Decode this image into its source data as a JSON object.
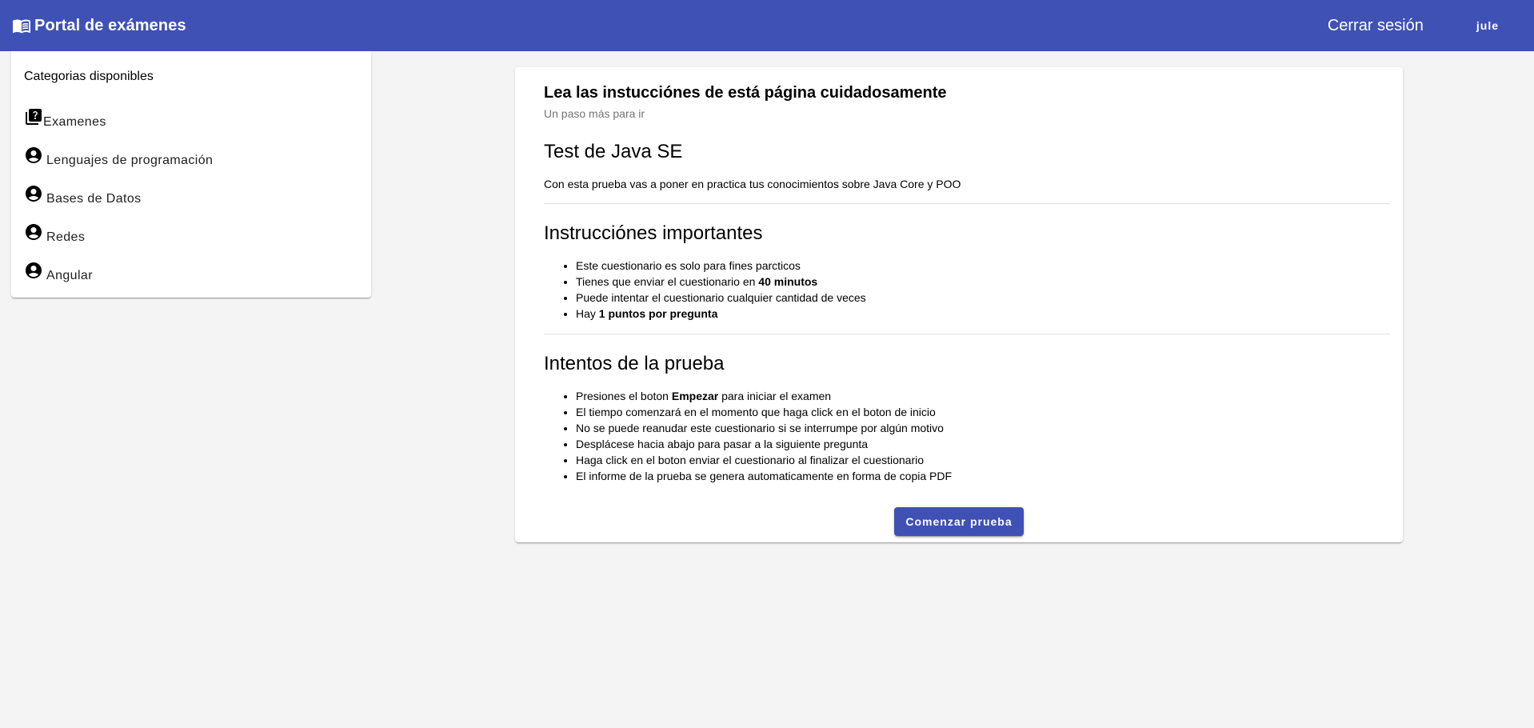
{
  "toolbar": {
    "brand_icon": "menu-book-icon",
    "brand_title": "Portal de exámenes",
    "logout_label": "Cerrar sesión",
    "user_label": "jule",
    "color": "#3f51b5"
  },
  "sidebar": {
    "subheader": "Categorias disponibles",
    "items": [
      {
        "icon": "quiz-icon",
        "label": "Examenes"
      },
      {
        "icon": "account-circle-icon",
        "label": "Lenguajes de programación"
      },
      {
        "icon": "account-circle-icon",
        "label": "Bases de Datos"
      },
      {
        "icon": "account-circle-icon",
        "label": "Redes"
      },
      {
        "icon": "account-circle-icon",
        "label": "Angular"
      }
    ]
  },
  "card": {
    "title": "Lea las instucciónes de está página cuidadosamente",
    "subtitle": "Un paso más para ir",
    "exam_title": "Test de Java SE",
    "exam_description": "Con esta prueba vas a poner en practica tus conocimientos sobre Java Core y POO",
    "instructions_heading": "Instrucciónes importantes",
    "instructions": [
      {
        "text": "Este cuestionario es solo para fines parcticos"
      },
      {
        "pre": "Tienes que enviar el cuestionario en ",
        "bold": "40 minutos",
        "post": ""
      },
      {
        "text": "Puede intentar el cuestionario cualquier cantidad de veces"
      },
      {
        "pre": "Hay ",
        "bold": "1 puntos por pregunta",
        "post": ""
      }
    ],
    "attempts_heading": "Intentos de la prueba",
    "attempts": [
      {
        "pre": "Presiones el boton ",
        "bold": "Empezar",
        "post": " para iniciar el examen"
      },
      {
        "text": "El tiempo comenzará en el momento que haga click en el boton de inicio"
      },
      {
        "text": "No se puede reanudar este cuestionario si se interrumpe por algún motivo"
      },
      {
        "text": "Desplácese hacia abajo para pasar a la siguiente pregunta"
      },
      {
        "text": "Haga click en el boton enviar el cuestionario al finalizar el cuestionario"
      },
      {
        "text": "El informe de la prueba se genera automaticamente en forma de copia PDF"
      }
    ],
    "start_button_label": "Comenzar prueba"
  }
}
